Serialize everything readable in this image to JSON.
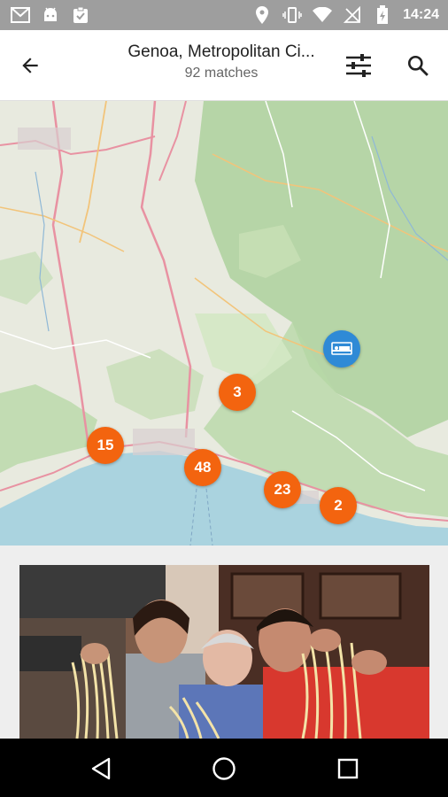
{
  "status_bar": {
    "time": "14:24",
    "icons": [
      "gmail-icon",
      "android-icon",
      "clipboard-icon",
      "location-icon",
      "vibrate-icon",
      "wifi-icon",
      "no-signal-icon",
      "battery-charging-icon"
    ]
  },
  "app_bar": {
    "title": "Genoa, Metropolitan Ci...",
    "subtitle": "92 matches",
    "back_icon": "arrow-back-icon",
    "filter_icon": "filter-sliders-icon",
    "search_icon": "search-icon"
  },
  "map": {
    "clusters": [
      {
        "count": "3"
      },
      {
        "count": "15"
      },
      {
        "count": "48"
      },
      {
        "count": "23"
      },
      {
        "count": "2"
      }
    ],
    "pin_icon": "bed-icon",
    "colors": {
      "cluster": "#f3640f",
      "pin": "#2f8ad6",
      "sea": "#aad3df",
      "land": "#e8eadf",
      "forest": "#add19e"
    }
  },
  "card": {
    "image": "photo-people-with-pasta"
  },
  "nav_bar": {
    "icons": [
      "back-triangle-icon",
      "home-circle-icon",
      "recents-square-icon"
    ]
  }
}
